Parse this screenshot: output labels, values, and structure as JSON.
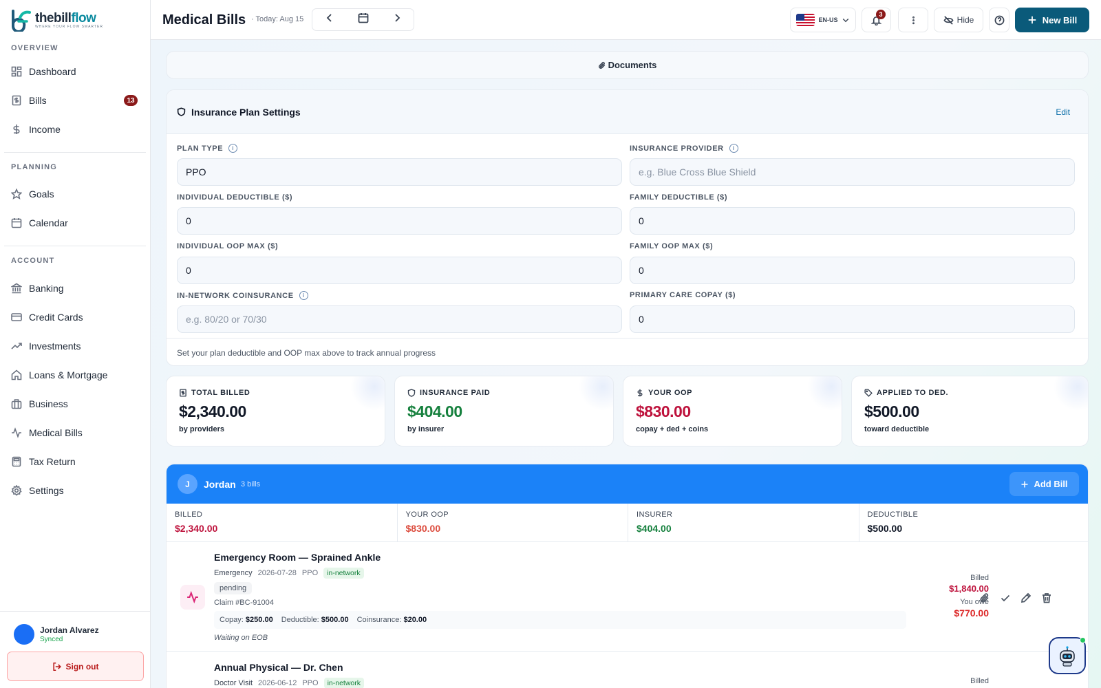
{
  "brand": {
    "name_part1": "thebill",
    "name_part2": "flow",
    "tagline": "WHERE YOUR FLOW SMARTER",
    "accent": "#0a5a7a"
  },
  "sidebar": {
    "sections": [
      {
        "label": "OVERVIEW"
      },
      {
        "label": "PLANNING"
      },
      {
        "label": "ACCOUNT"
      }
    ],
    "items": [
      {
        "label": "Dashboard",
        "icon": "dashboard-icon"
      },
      {
        "label": "Bills",
        "icon": "bill-icon",
        "badge": "13"
      },
      {
        "label": "Income",
        "icon": "dollar-icon"
      },
      {
        "label": "Goals",
        "icon": "star-icon"
      },
      {
        "label": "Calendar",
        "icon": "calendar-icon"
      },
      {
        "label": "Banking",
        "icon": "bank-icon"
      },
      {
        "label": "Credit Cards",
        "icon": "credit-card-icon"
      },
      {
        "label": "Investments",
        "icon": "trend-up-icon"
      },
      {
        "label": "Loans & Mortgage",
        "icon": "home-icon"
      },
      {
        "label": "Business",
        "icon": "briefcase-icon"
      },
      {
        "label": "Medical Bills",
        "icon": "pulse-icon"
      },
      {
        "label": "Tax Return",
        "icon": "calculator-icon"
      },
      {
        "label": "Settings",
        "icon": "gear-icon"
      }
    ],
    "user": {
      "name": "Jordan Alvarez",
      "status": "Synced"
    },
    "signout_label": "Sign out"
  },
  "header": {
    "title": "Medical Bills",
    "today": "· Today: Aug 15",
    "locale": "EN-US",
    "notifications": "3",
    "hide_label": "Hide",
    "new_bill_label": "New Bill"
  },
  "documents": {
    "label": "Documents"
  },
  "insurance": {
    "title": "Insurance Plan Settings",
    "edit_label": "Edit",
    "fields": [
      {
        "label": "PLAN TYPE",
        "value": "PPO",
        "placeholder": "",
        "info": true
      },
      {
        "label": "INSURANCE PROVIDER",
        "value": "",
        "placeholder": "e.g. Blue Cross Blue Shield",
        "info": true
      },
      {
        "label": "INDIVIDUAL DEDUCTIBLE ($)",
        "value": "0",
        "placeholder": "",
        "info": false
      },
      {
        "label": "FAMILY DEDUCTIBLE ($)",
        "value": "0",
        "placeholder": "",
        "info": false
      },
      {
        "label": "INDIVIDUAL OOP MAX ($)",
        "value": "0",
        "placeholder": "",
        "info": false
      },
      {
        "label": "FAMILY OOP MAX ($)",
        "value": "0",
        "placeholder": "",
        "info": false
      },
      {
        "label": "IN-NETWORK COINSURANCE",
        "value": "",
        "placeholder": "e.g. 80/20 or 70/30",
        "info": true
      },
      {
        "label": "PRIMARY CARE COPAY ($)",
        "value": "0",
        "placeholder": "",
        "info": false
      }
    ],
    "footer": "Set your plan deductible and OOP max above to track annual progress"
  },
  "stats": [
    {
      "label": "TOTAL BILLED",
      "value": "$2,340.00",
      "sub": "by providers",
      "color": "#111827",
      "icon": "receipt-icon"
    },
    {
      "label": "INSURANCE PAID",
      "value": "$404.00",
      "sub": "by insurer",
      "color": "#15803d",
      "icon": "shield-icon"
    },
    {
      "label": "YOUR OOP",
      "value": "$830.00",
      "sub": "copay + ded + coins",
      "color": "#be123c",
      "icon": "dollar-icon"
    },
    {
      "label": "APPLIED TO DED.",
      "value": "$500.00",
      "sub": "toward deductible",
      "color": "#111827",
      "icon": "tag-icon"
    }
  ],
  "person": {
    "initial": "J",
    "name": "Jordan",
    "count": "3 bills",
    "add_label": "Add Bill",
    "header_color": "#1b82f8",
    "summary": [
      {
        "label": "BILLED",
        "value": "$2,340.00",
        "color": "#be123c"
      },
      {
        "label": "YOUR OOP",
        "value": "$830.00",
        "color": "#dc4c3e"
      },
      {
        "label": "INSURER",
        "value": "$404.00",
        "color": "#15803d"
      },
      {
        "label": "DEDUCTIBLE",
        "value": "$500.00",
        "color": "#111827"
      }
    ],
    "bills": [
      {
        "title": "Emergency Room — Sprained Ankle",
        "category": "Emergency",
        "date": "2026-07-28",
        "plan": "PPO",
        "network": "in-network",
        "status": "pending",
        "claim": "Claim #BC-91004",
        "copay_label": "Copay:",
        "copay": "$250.00",
        "deductible_label": "Deductible:",
        "deductible": "$500.00",
        "coinsurance_label": "Coinsurance:",
        "coinsurance": "$20.00",
        "note": "Waiting on EOB",
        "billed_label": "Billed",
        "billed": "$1,840.00",
        "owe_label": "You owe",
        "owe": "$770.00"
      },
      {
        "title": "Annual Physical — Dr. Chen",
        "category": "Doctor Visit",
        "date": "2026-06-12",
        "plan": "PPO",
        "network": "in-network",
        "billed_label": "Billed"
      }
    ]
  }
}
